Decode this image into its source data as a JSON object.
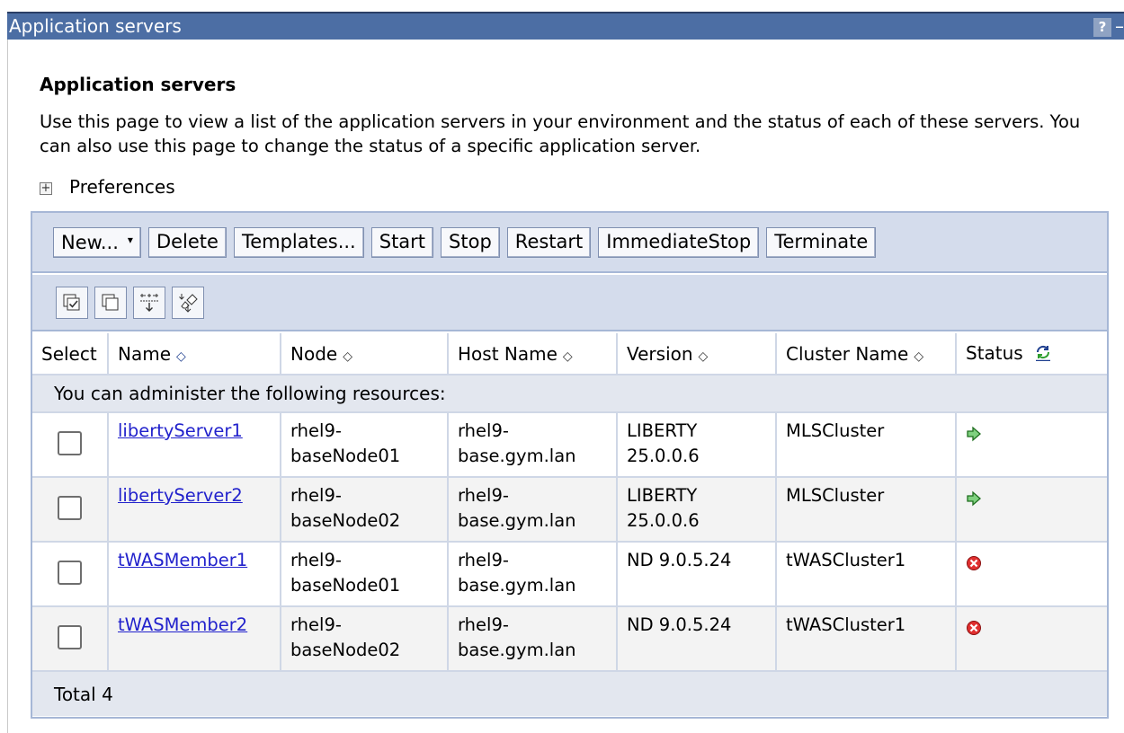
{
  "window": {
    "title": "Application servers",
    "help_label": "?",
    "minimize_label": "–"
  },
  "page": {
    "heading": "Application servers",
    "description": "Use this page to view a list of the application servers in your environment and the status of each of these servers. You can also use this page to change the status of a specific application server.",
    "preferences_label": "Preferences",
    "preferences_toggle": "+"
  },
  "toolbar": {
    "new_label": "New...",
    "new_caret": "▾",
    "delete_label": "Delete",
    "templates_label": "Templates...",
    "start_label": "Start",
    "stop_label": "Stop",
    "restart_label": "Restart",
    "immediate_stop_label": "ImmediateStop",
    "terminate_label": "Terminate"
  },
  "icon_toolbar": [
    "select-all-icon",
    "deselect-all-icon",
    "show-filter-icon",
    "clear-filter-icon"
  ],
  "table": {
    "headers": {
      "select": "Select",
      "name": "Name",
      "node": "Node",
      "host": "Host Name",
      "version": "Version",
      "cluster": "Cluster Name",
      "status": "Status"
    },
    "sort_glyph": "◇",
    "section_label": "You can administer the following resources:",
    "rows": [
      {
        "name": "libertyServer1",
        "node": "rhel9-baseNode01",
        "host": "rhel9-base.gym.lan",
        "version": "LIBERTY 25.0.0.6",
        "cluster": "MLSCluster",
        "status": "started"
      },
      {
        "name": "libertyServer2",
        "node": "rhel9-baseNode02",
        "host": "rhel9-base.gym.lan",
        "version": "LIBERTY 25.0.0.6",
        "cluster": "MLSCluster",
        "status": "started"
      },
      {
        "name": "tWASMember1",
        "node": "rhel9-baseNode01",
        "host": "rhel9-base.gym.lan",
        "version": "ND 9.0.5.24",
        "cluster": "tWASCluster1",
        "status": "stopped"
      },
      {
        "name": "tWASMember2",
        "node": "rhel9-baseNode02",
        "host": "rhel9-base.gym.lan",
        "version": "ND 9.0.5.24",
        "cluster": "tWASCluster1",
        "status": "stopped"
      }
    ],
    "total_label": "Total 4"
  },
  "colors": {
    "titlebar": "#4c6ea4",
    "toolbar_bg": "#d4dcec",
    "link": "#2222cc",
    "status_started": "#2e9e2e",
    "status_stopped": "#cc2222"
  }
}
